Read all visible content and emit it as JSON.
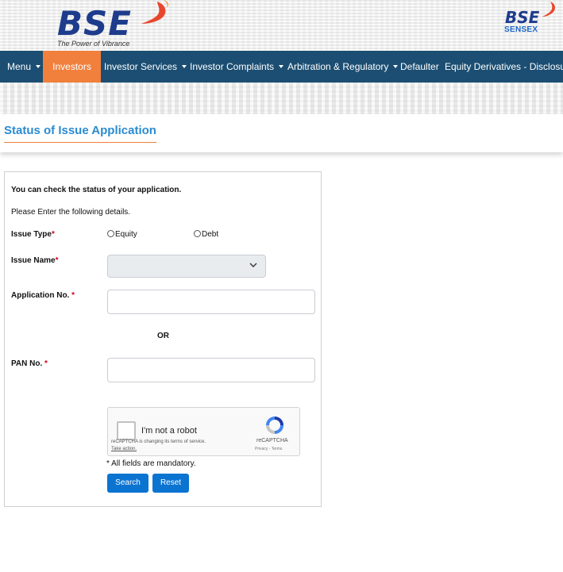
{
  "header": {
    "logo_text": "BSE",
    "tagline": "The Power of Vibrance",
    "right_logo_text": "BSE",
    "right_logo_sub": "SENSEX"
  },
  "nav": {
    "items": [
      {
        "label": "Menu",
        "dropdown": true
      },
      {
        "label": "Investors",
        "dropdown": false,
        "active": true
      },
      {
        "label": "Investor Services",
        "dropdown": true
      },
      {
        "label": "Investor Complaints",
        "dropdown": true
      },
      {
        "label": "Arbitration & Regulatory",
        "dropdown": true
      },
      {
        "label": "Defaulter",
        "dropdown": false
      },
      {
        "label": "Equity Derivatives - Disclosure",
        "dropdown": false
      }
    ]
  },
  "page": {
    "title": "Status of Issue Application"
  },
  "form": {
    "intro": "You can check the status of your application.",
    "instruction": "Please Enter the following details.",
    "issue_type_label": "Issue Type",
    "issue_type_options": [
      "Equity",
      "Debt"
    ],
    "issue_name_label": "Issue Name",
    "issue_name_value": "",
    "application_no_label": "Application No.",
    "application_no_value": "",
    "or_text": "OR",
    "pan_label": "PAN No.",
    "pan_value": "",
    "required_mark": "*",
    "mandatory_note": "* All fields are mandatory.",
    "search_label": "Search",
    "reset_label": "Reset"
  },
  "captcha": {
    "label": "I'm not a robot",
    "change_notice": "reCAPTCHA is changing its terms of service.",
    "take_action": "Take action.",
    "brand": "reCAPTCHA",
    "privacy_terms": "Privacy - Terms"
  },
  "colors": {
    "nav_bg": "#1b4e72",
    "nav_active": "#f0803c",
    "title_color": "#2a8bd1",
    "button_bg": "#0b74d1",
    "brand_blue": "#1e3c8c",
    "brand_red": "#e8472e"
  },
  "icons": [
    "bse-swoosh-icon",
    "caret-down-icon",
    "chevron-down-icon",
    "recaptcha-icon"
  ]
}
